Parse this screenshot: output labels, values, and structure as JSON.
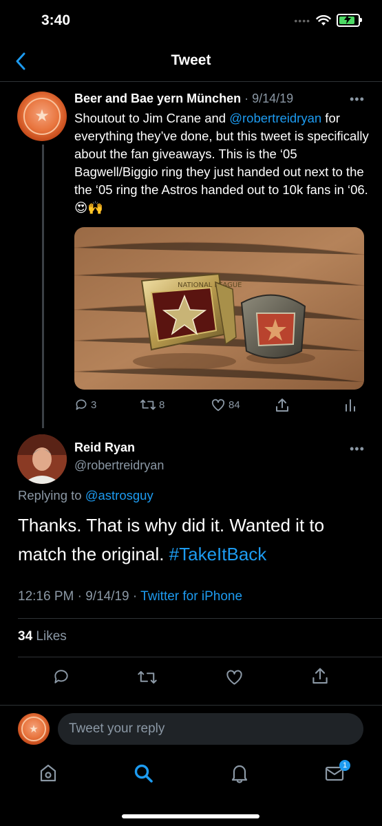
{
  "status_bar": {
    "time": "3:40"
  },
  "header": {
    "title": "Tweet"
  },
  "original_tweet": {
    "display_name": "Beer and Bae yern München",
    "separator": "·",
    "date": "9/14/19",
    "more": "•••",
    "text_part1": "Shoutout to Jim Crane and ",
    "mention": "@robertreidryan",
    "text_part2": " for everything they’ve done, but this tweet is specifically about the fan giveaways. This is the ‘05 Bagwell/Biggio ring they just handed out next to the the ‘05 ring the Astros handed out to 10k fans in ‘06. 😍🙌",
    "replies": "3",
    "retweets": "8",
    "likes": "84"
  },
  "reply_tweet": {
    "display_name": "Reid Ryan",
    "handle": "@robertreidryan",
    "more": "•••",
    "replying_label": "Replying to ",
    "replying_to": "@astrosguy",
    "text": "Thanks. That is why did it. Wanted it to match the original. ",
    "hashtag": "#TakeItBack",
    "time": "12:16 PM",
    "date": "9/14/19",
    "sep": "·",
    "source": "Twitter for iPhone",
    "likes_count": "34",
    "likes_label": "Likes"
  },
  "composer": {
    "placeholder": "Tweet your reply"
  },
  "tabbar": {
    "messages_badge": "1"
  },
  "colors": {
    "accent": "#1d9bf0",
    "background": "#000000",
    "muted": "#8b98a5"
  }
}
